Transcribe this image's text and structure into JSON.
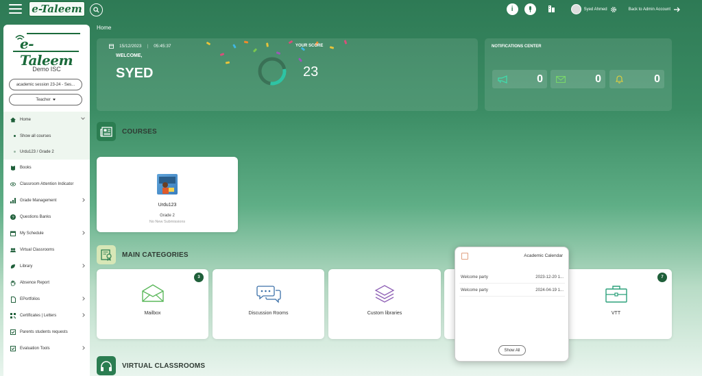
{
  "topbar": {
    "logo_text": "e-Taleem",
    "user_name": "Syed Ahmed",
    "back_label": "Back to Admin Account"
  },
  "sidebar": {
    "logo_text": "e-Taleem",
    "school_name": "Demo ISC",
    "session_select": "academic session 23-24 - Ses...",
    "role_select": "Teacher",
    "home_label": "Home",
    "home_subitems": [
      "Show all courses",
      "Urdu123 / Grade 2"
    ],
    "items": [
      {
        "label": "Books",
        "icon": "book-icon"
      },
      {
        "label": "Classroom Attention Indicator",
        "icon": "eye-icon"
      },
      {
        "label": "Grade Management",
        "icon": "bar-chart-icon"
      },
      {
        "label": "Questions Banks",
        "icon": "question-icon"
      },
      {
        "label": "My Schedule",
        "icon": "calendar-icon"
      },
      {
        "label": "Virtual Classrooms",
        "icon": "users-icon"
      },
      {
        "label": "Library",
        "icon": "leaf-icon"
      },
      {
        "label": "Absence Report",
        "icon": "hand-icon"
      },
      {
        "label": "EPortfolios",
        "icon": "document-icon"
      },
      {
        "label": "Certificates | Letters",
        "icon": "qr-icon"
      },
      {
        "label": "Parents students requests",
        "icon": "check-square-icon"
      },
      {
        "label": "Evaluation Tools",
        "icon": "check-square-icon"
      }
    ]
  },
  "breadcrumb": "Home",
  "welcome": {
    "date": "15/12/2023",
    "time": "05:45:37",
    "greeting": "WELCOME,",
    "name": "SYED",
    "score_label": "YOUR SCORE",
    "score": "23"
  },
  "notifications": {
    "title": "NOTIFICATIONS CENTER",
    "announcements": "0",
    "messages": "0",
    "alerts": "0"
  },
  "sections": {
    "courses": "COURSES",
    "main_categories": "MAIN CATEGORIES",
    "virtual_classrooms": "VIRTUAL CLASSROOMS"
  },
  "course": {
    "name": "Urdu123",
    "grade": "Grade 2",
    "status": "No New Submissions"
  },
  "categories": [
    {
      "label": "Mailbox",
      "badge": "3"
    },
    {
      "label": "Discussion Rooms",
      "badge": ""
    },
    {
      "label": "Custom libraries",
      "badge": ""
    },
    {
      "label": "VTT",
      "badge": "7"
    }
  ],
  "calendar_popup": {
    "title": "Academic Calendar",
    "events": [
      {
        "name": "Welcome party",
        "date": "2023-12-20 1..."
      },
      {
        "name": "Welcome party",
        "date": "2024-04-19 1..."
      }
    ],
    "show_all": "Show All"
  },
  "colors": {
    "brand_green": "#2b7d51",
    "dark_green": "#1f5f3a"
  }
}
